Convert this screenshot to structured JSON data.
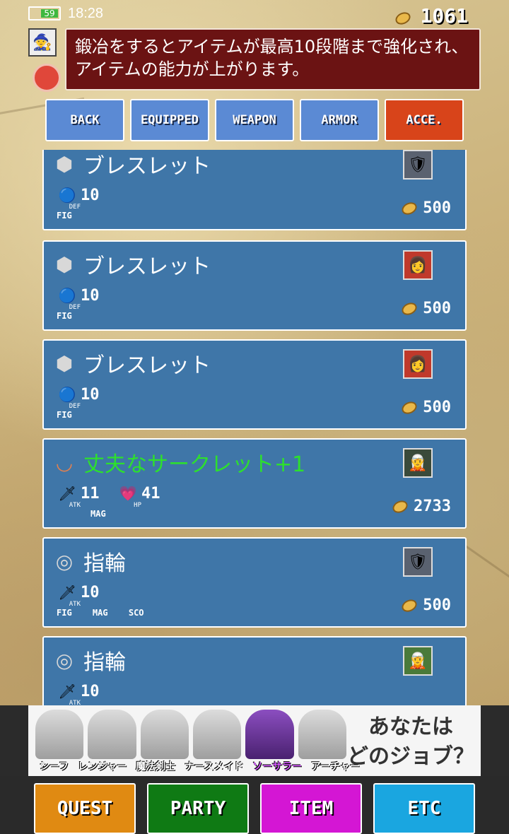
{
  "status": {
    "battery": "59",
    "time": "18:28"
  },
  "coins": "1061",
  "message": "鍛冶をするとアイテムが最高10段階まで強化され、アイテムの能力が上がります。",
  "tabs": [
    {
      "label": "BACK",
      "active": false
    },
    {
      "label": "EQUIPPED",
      "active": false
    },
    {
      "label": "WEAPON",
      "active": false
    },
    {
      "label": "ARMOR",
      "active": false
    },
    {
      "label": "ACCE.",
      "active": true
    }
  ],
  "items": [
    {
      "icon": "bracelet-icon",
      "name": "ブレスレット",
      "stat_icon": "def-icon",
      "stat_tag": "DEF",
      "stat_value": "10",
      "stat2_tag": "",
      "stat2_value": "",
      "jobs": [
        "FIG"
      ],
      "price": "500",
      "portrait": "knight-portrait"
    },
    {
      "icon": "bracelet-icon",
      "name": "ブレスレット",
      "stat_icon": "def-icon",
      "stat_tag": "DEF",
      "stat_value": "10",
      "stat2_tag": "",
      "stat2_value": "",
      "jobs": [
        "FIG"
      ],
      "price": "500",
      "portrait": "redhair-portrait"
    },
    {
      "icon": "bracelet-icon",
      "name": "ブレスレット",
      "stat_icon": "def-icon",
      "stat_tag": "DEF",
      "stat_value": "10",
      "stat2_tag": "",
      "stat2_value": "",
      "jobs": [
        "FIG"
      ],
      "price": "500",
      "portrait": "redhair-portrait"
    },
    {
      "icon": "circlet-icon",
      "name": "丈夫なサークレット+1",
      "stat_icon": "atk-icon",
      "stat_tag": "ATK",
      "stat_value": "11",
      "stat2_tag": "HP",
      "stat2_value": "41",
      "jobs": [
        "MAG"
      ],
      "price": "2733",
      "portrait": "witch-portrait",
      "highlight": true
    },
    {
      "icon": "ring-icon",
      "name": "指輪",
      "stat_icon": "atk-icon",
      "stat_tag": "ATK",
      "stat_value": "10",
      "stat2_tag": "",
      "stat2_value": "",
      "jobs": [
        "FIG",
        "MAG",
        "SCO"
      ],
      "price": "500",
      "portrait": "knight-portrait"
    },
    {
      "icon": "ring-icon",
      "name": "指輪",
      "stat_icon": "atk-icon",
      "stat_tag": "ATK",
      "stat_value": "10",
      "stat2_tag": "",
      "stat2_value": "",
      "jobs": [],
      "price": "",
      "portrait": "elf-portrait"
    }
  ],
  "ad": {
    "jobs": [
      "シーフ",
      "レンジャー",
      "魔法剣士",
      "ナースメイド",
      "ソーサラー",
      "アーチャー"
    ],
    "headline_line1": "あなたは",
    "headline_line2": "どのジョブ？"
  },
  "nav": [
    {
      "label": "QUEST",
      "color": "#e08a12"
    },
    {
      "label": "PARTY",
      "color": "#0f7a14"
    },
    {
      "label": "ITEM",
      "color": "#d416d4"
    },
    {
      "label": "ETC",
      "color": "#1aa6e0"
    }
  ]
}
